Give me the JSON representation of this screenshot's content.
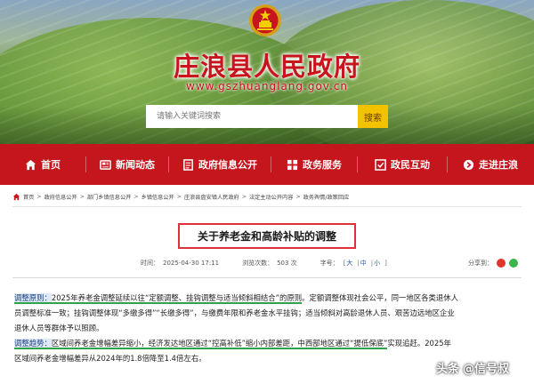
{
  "header": {
    "site_title": "庄浪县人民政府",
    "site_url": "www.gszhuanglang.gov.cn",
    "search_placeholder": "请输入关键词搜索",
    "search_button": "搜索"
  },
  "nav": {
    "items": [
      {
        "label": "首页",
        "icon": "home-icon"
      },
      {
        "label": "新闻动态",
        "icon": "news-icon"
      },
      {
        "label": "政府信息公开",
        "icon": "document-icon"
      },
      {
        "label": "政务服务",
        "icon": "service-icon"
      },
      {
        "label": "政民互动",
        "icon": "interaction-icon"
      },
      {
        "label": "走进庄浪",
        "icon": "arrow-right-icon"
      }
    ]
  },
  "breadcrumb": [
    "首页",
    "政府信息公开",
    "部门乡镇信息公开",
    "乡镇信息公开",
    "庄浪县盘安镇人民政府",
    "法定主动公开内容",
    "政务舆情/政策回应"
  ],
  "article": {
    "title": "关于养老金和高龄补贴的调整",
    "time_label": "时间：",
    "time_value": "2025-04-30 17:11",
    "views_label": "浏览次数：",
    "views_value": "503 次",
    "font_label": "字号：",
    "font_sizes": [
      "大",
      "中",
      "小"
    ],
    "share_label": "分享到：",
    "paragraphs": {
      "p1_l1_a": "调整原则：",
      "p1_l1_b": "2025年养老金调整延续以往",
      "p1_l1_c": "“定额调整、挂钩调整与适当倾斜相结合”的原则",
      "p1_l1_d": "。定额调整体现社会公平，同一地区各类退休人",
      "p1_l2": "员调整标准一致；挂钩调整体现“多缴多得”“长缴多得”，与缴费年限和养老金水平挂钩；适当倾斜对高龄退休人员、艰苦边远地区企业",
      "p1_l3": "退休人员等群体予以照顾。",
      "p2_l1_a": "调整趋势：",
      "p2_l1_b": "区域间养老金增幅差异缩小",
      "p2_l1_c": "，",
      "p2_l1_d": "经济发达地区通过“控高补低”缩小内部差距，中西部地区通过“提低保底”",
      "p2_l1_e": "实现追赶。2025年",
      "p2_l2": "区域间养老金增幅差异从2024年的1.8倍降至1.4倍左右。"
    }
  },
  "watermark": {
    "brand": "头条",
    "author": "@信号叔"
  },
  "colors": {
    "brand_red": "#c4161c",
    "title_red": "#c8141c",
    "search_yellow": "#f2c200",
    "highlight_green": "#2fa24a",
    "title_border": "#e2303a"
  }
}
